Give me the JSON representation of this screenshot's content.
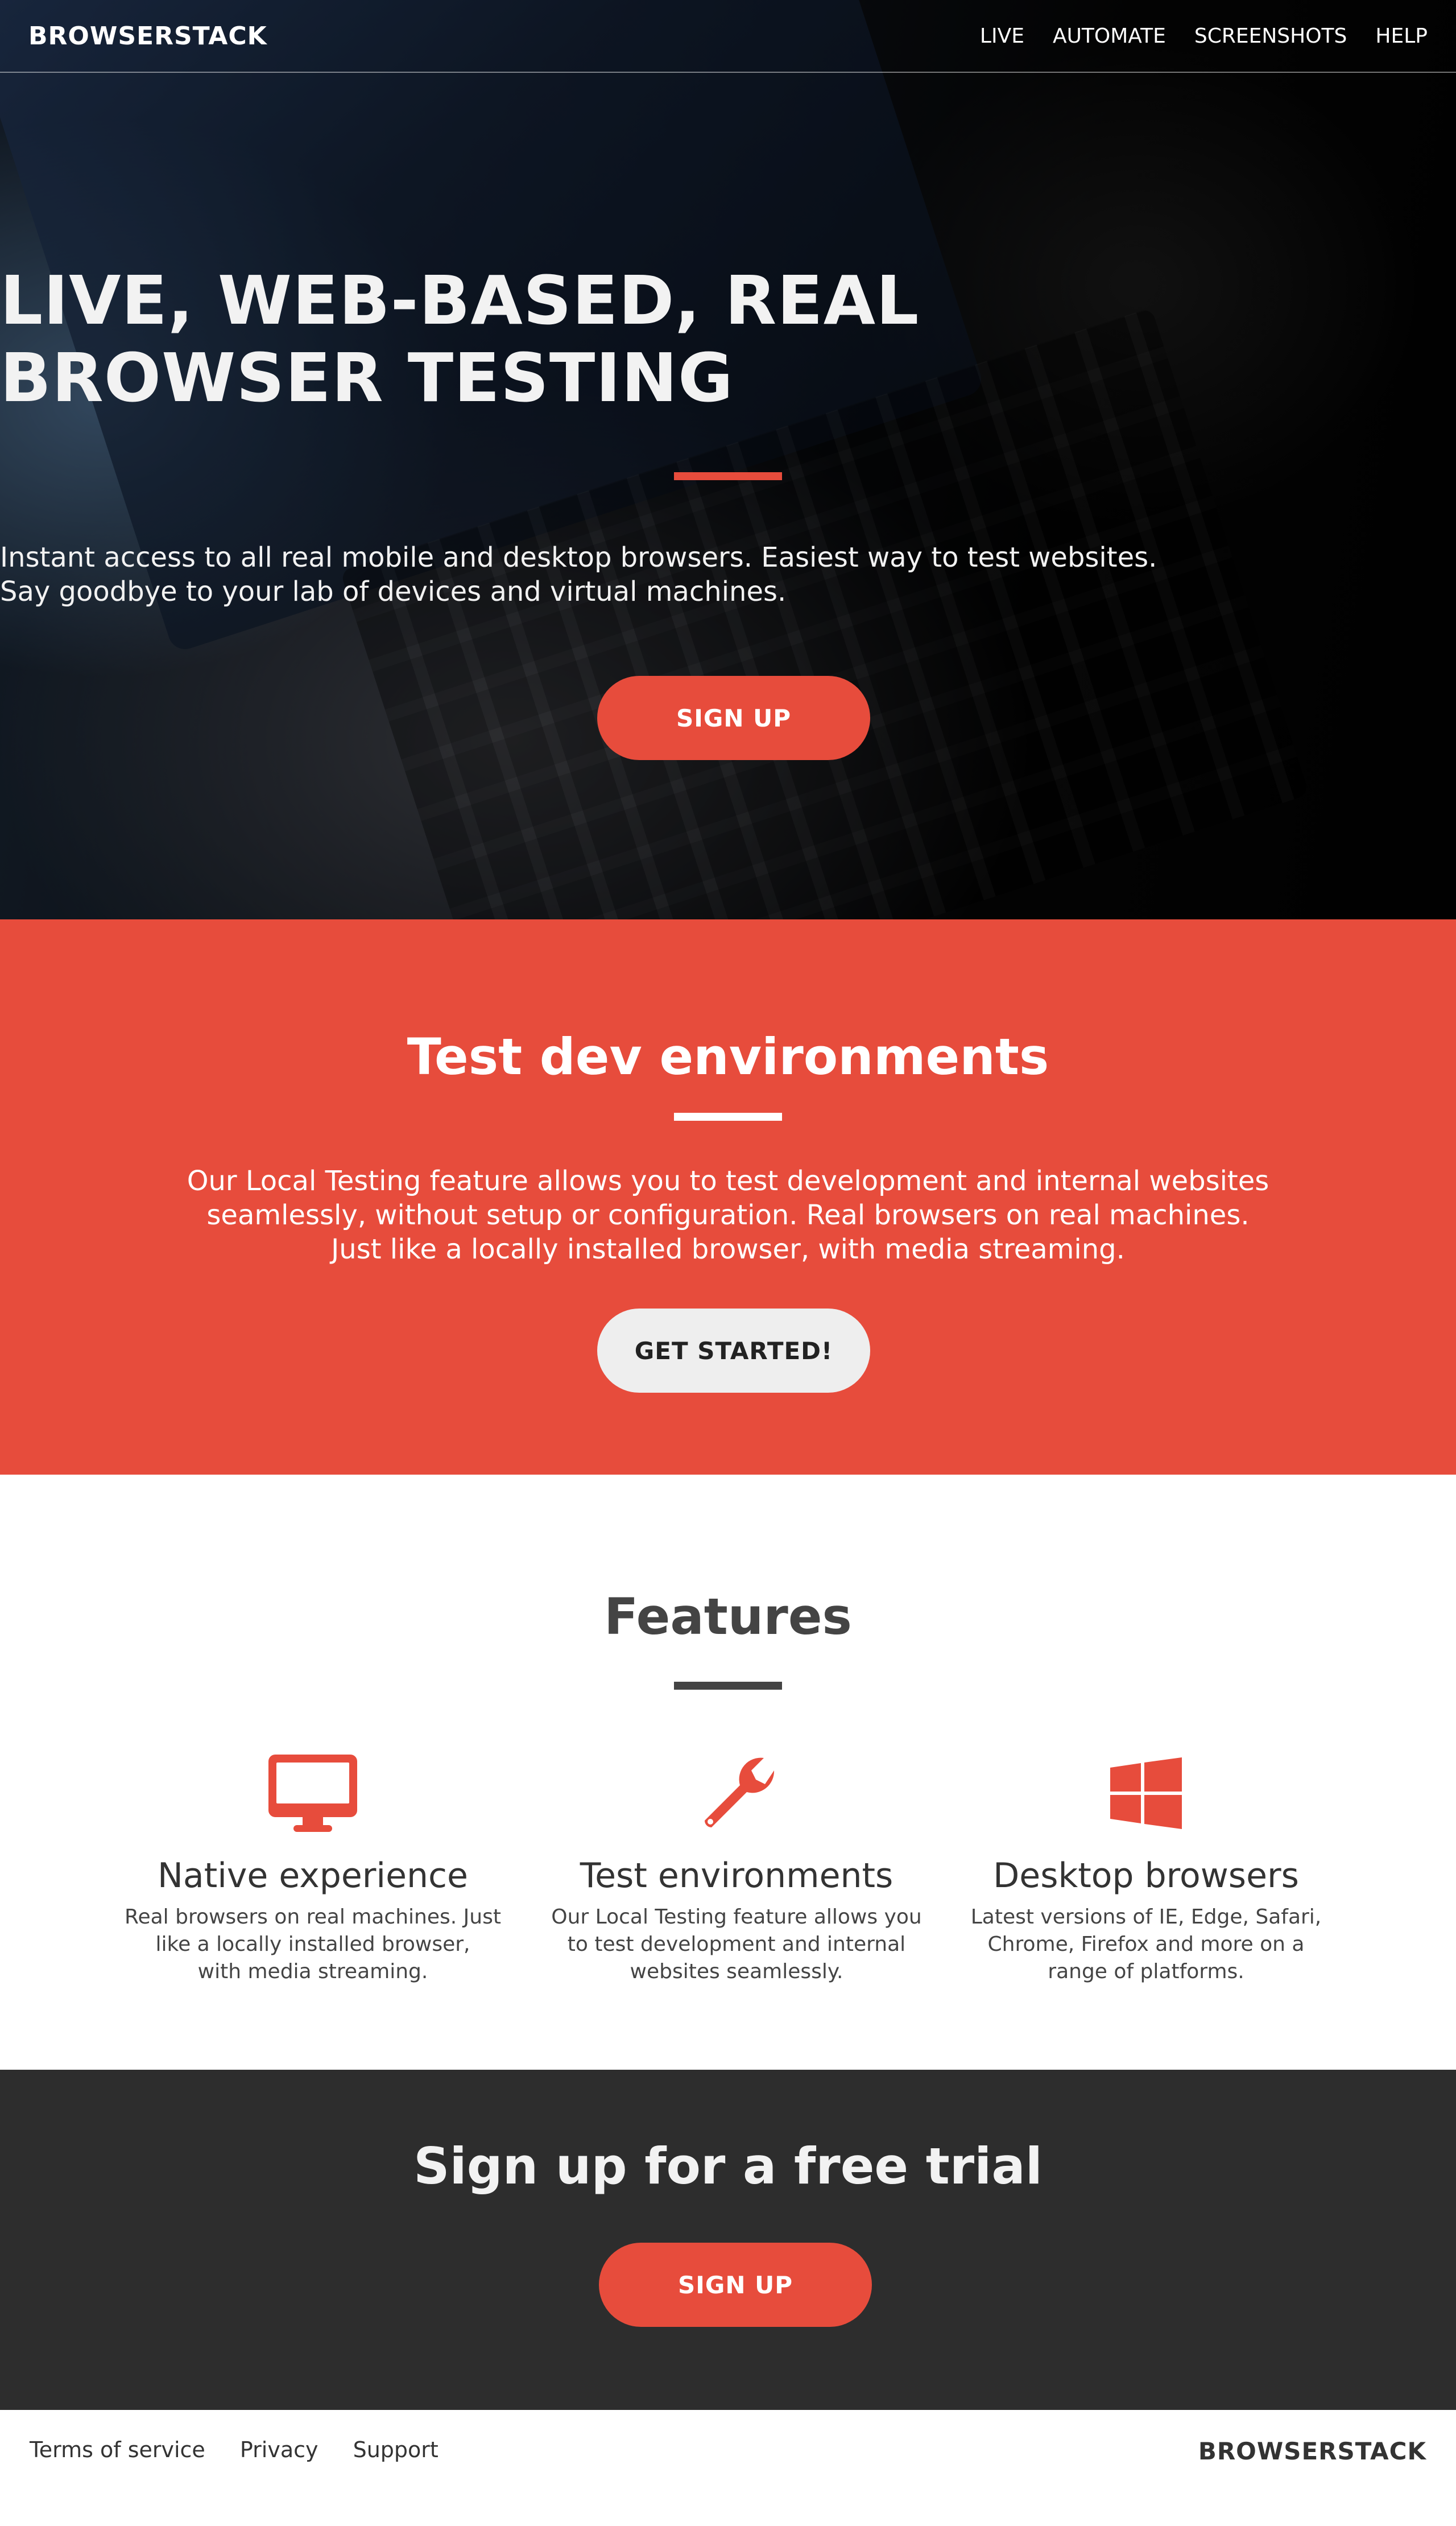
{
  "nav": {
    "brand": "BROWSERSTACK",
    "links": [
      "LIVE",
      "AUTOMATE",
      "SCREENSHOTS",
      "HELP"
    ]
  },
  "hero": {
    "title_line1": "LIVE, WEB-BASED, REAL",
    "title_line2": "BROWSER TESTING",
    "subtitle_line1": "Instant access to all real mobile and desktop browsers. Easiest way to test websites.",
    "subtitle_line2": "Say goodbye to your lab of devices and virtual machines.",
    "cta": "SIGN UP"
  },
  "local": {
    "title": "Test dev environments",
    "text_line1": "Our Local Testing feature allows you to test development and internal websites",
    "text_line2": "seamlessly, without setup or configuration. Real browsers on real machines.",
    "text_line3": "Just like a locally installed browser, with media streaming.",
    "cta": "GET STARTED!"
  },
  "features": {
    "title": "Features",
    "items": [
      {
        "icon": "monitor-icon",
        "name": "Native experience",
        "desc_line1": "Real browsers on real machines. Just",
        "desc_line2": "like a locally installed browser,",
        "desc_line3": "with media streaming."
      },
      {
        "icon": "wrench-icon",
        "name": "Test environments",
        "desc_line1": "Our Local Testing feature allows you",
        "desc_line2": "to test  development and internal",
        "desc_line3": "websites seamlessly."
      },
      {
        "icon": "windows-icon",
        "name": "Desktop browsers",
        "desc_line1": "Latest versions of IE, Edge, Safari,",
        "desc_line2": "Chrome, Firefox and more on a",
        "desc_line3": "range of platforms."
      }
    ]
  },
  "trial": {
    "title": "Sign up for a free trial",
    "cta": "SIGN UP"
  },
  "footer": {
    "links": [
      "Terms of service",
      "Privacy",
      "Support"
    ],
    "brand": "BROWSERSTACK"
  },
  "colors": {
    "accent": "#e74c3c",
    "dark": "#2d2d2d",
    "light_button": "#eeeeee"
  }
}
